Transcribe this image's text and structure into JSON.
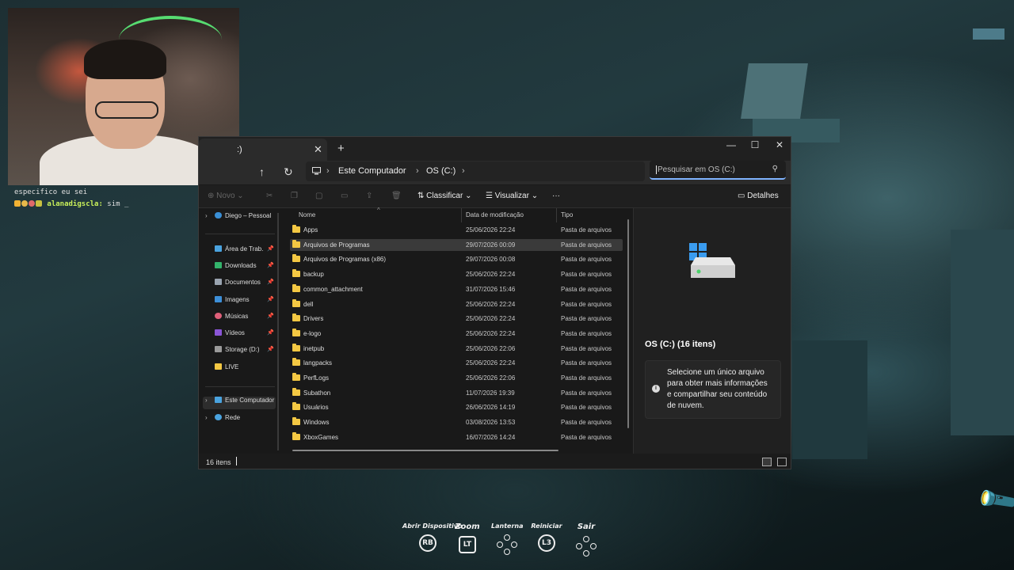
{
  "webcam": {
    "chat_line1": "especifico eu sei",
    "chat_user": "alanadigscla:",
    "chat_msg": "sim _"
  },
  "window": {
    "tab_title": ":)",
    "tab_close": "✕",
    "tab_add": "+",
    "minimize": "—",
    "maximize": "☐",
    "close": "✕"
  },
  "nav": {
    "up_icon": "↑",
    "refresh_icon": "↻",
    "breadcrumb": [
      "Este Computador",
      "OS (C:)"
    ],
    "search_placeholder": "Pesquisar em OS (C:)"
  },
  "commands": {
    "new": "Novo",
    "sort": "Classificar",
    "view": "Visualizar",
    "more": "···",
    "details": "Detalhes"
  },
  "sidebar": {
    "items": [
      {
        "label": "Diego – Pessoal",
        "icon": "cloud-icon"
      },
      {
        "label": "Área de Trab.",
        "icon": "desktop-icon"
      },
      {
        "label": "Downloads",
        "icon": "download-icon"
      },
      {
        "label": "Documentos",
        "icon": "document-icon"
      },
      {
        "label": "Imagens",
        "icon": "image-icon"
      },
      {
        "label": "Músicas",
        "icon": "music-icon"
      },
      {
        "label": "Vídeos",
        "icon": "video-icon"
      },
      {
        "label": "Storage (D:)",
        "icon": "drive-icon"
      },
      {
        "label": "LIVE",
        "icon": "folder-icon"
      },
      {
        "label": "Este Computador",
        "icon": "computer-icon"
      },
      {
        "label": "Rede",
        "icon": "network-icon"
      }
    ]
  },
  "list": {
    "headers": {
      "name": "Nome",
      "date": "Data de modificação",
      "type": "Tipo"
    },
    "rows": [
      {
        "name": "Apps",
        "date": "25/06/2026 22:24",
        "type": "Pasta de arquivos"
      },
      {
        "name": "Arquivos de Programas",
        "date": "29/07/2026 00:09",
        "type": "Pasta de arquivos"
      },
      {
        "name": "Arquivos de Programas (x86)",
        "date": "29/07/2026 00:08",
        "type": "Pasta de arquivos"
      },
      {
        "name": "backup",
        "date": "25/06/2026 22:24",
        "type": "Pasta de arquivos"
      },
      {
        "name": "common_attachment",
        "date": "31/07/2026 15:46",
        "type": "Pasta de arquivos"
      },
      {
        "name": "dell",
        "date": "25/06/2026 22:24",
        "type": "Pasta de arquivos"
      },
      {
        "name": "Drivers",
        "date": "25/06/2026 22:24",
        "type": "Pasta de arquivos"
      },
      {
        "name": "e-logo",
        "date": "25/06/2026 22:24",
        "type": "Pasta de arquivos"
      },
      {
        "name": "inetpub",
        "date": "25/06/2026 22:06",
        "type": "Pasta de arquivos"
      },
      {
        "name": "langpacks",
        "date": "25/06/2026 22:24",
        "type": "Pasta de arquivos"
      },
      {
        "name": "PerfLogs",
        "date": "25/06/2026 22:06",
        "type": "Pasta de arquivos"
      },
      {
        "name": "Subathon",
        "date": "11/07/2026 19:39",
        "type": "Pasta de arquivos"
      },
      {
        "name": "Usuários",
        "date": "26/06/2026 14:19",
        "type": "Pasta de arquivos"
      },
      {
        "name": "Windows",
        "date": "03/08/2026 13:53",
        "type": "Pasta de arquivos"
      },
      {
        "name": "XboxGames",
        "date": "16/07/2026 14:24",
        "type": "Pasta de arquivos"
      }
    ]
  },
  "details": {
    "title": "OS (C:) (16 itens)",
    "info": "Selecione um único arquivo para obter mais informações e compartilhar seu conteúdo de nuvem."
  },
  "status": {
    "count": "16 itens"
  },
  "hud": {
    "items": [
      {
        "label": "Abrir Dispositivo",
        "key": "RB"
      },
      {
        "label": "Zoom",
        "key": "LT"
      },
      {
        "label": "Lanterna",
        "key": ""
      },
      {
        "label": "Reiniciar",
        "key": "L3"
      },
      {
        "label": "Sair",
        "key": ""
      }
    ]
  }
}
